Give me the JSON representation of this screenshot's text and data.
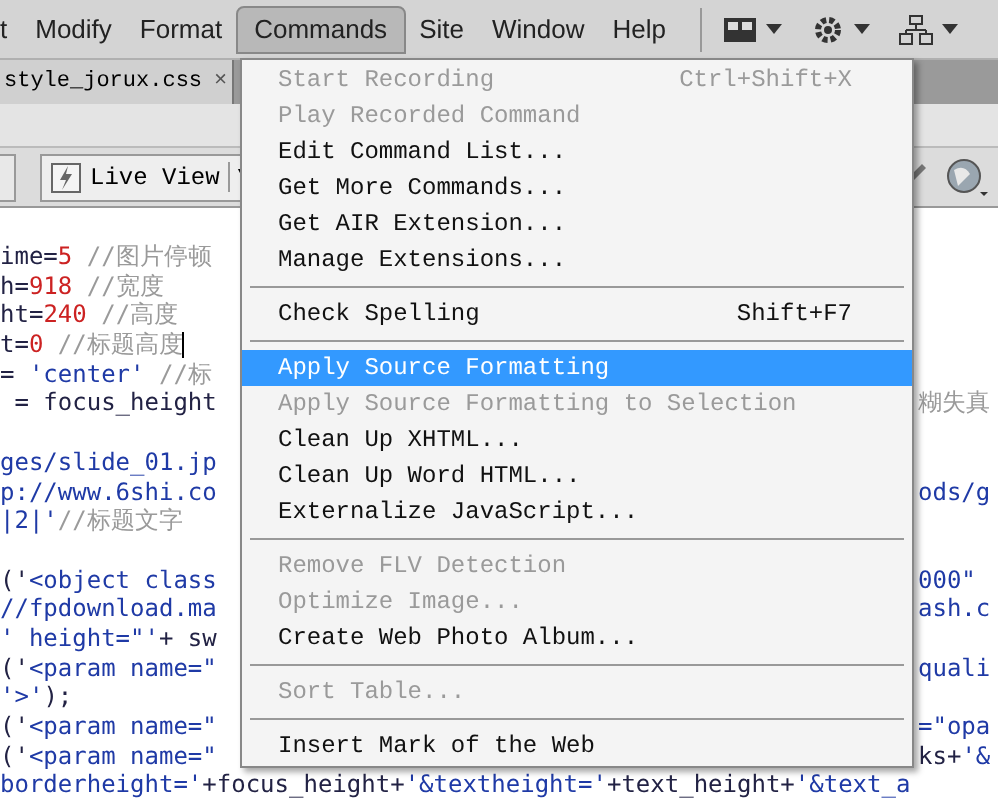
{
  "menu_bar": {
    "items": [
      {
        "label": "t",
        "selected": false
      },
      {
        "label": "Modify",
        "selected": false
      },
      {
        "label": "Format",
        "selected": false
      },
      {
        "label": "Commands",
        "selected": true
      },
      {
        "label": "Site",
        "selected": false
      },
      {
        "label": "Window",
        "selected": false
      },
      {
        "label": "Help",
        "selected": false
      }
    ]
  },
  "document_tabs": [
    {
      "label": "style_jorux.css",
      "close": "×"
    }
  ],
  "toolbar": {
    "live_view": {
      "label": "Live View"
    }
  },
  "code": [
    {
      "kind": "code",
      "left": [
        {
          "text": "ime=",
          "kind": "plain"
        },
        {
          "text": "5",
          "kind": "number"
        },
        {
          "text": " //图片停顿",
          "kind": "comment"
        }
      ]
    },
    {
      "kind": "code",
      "left": [
        {
          "text": "h=",
          "kind": "plain"
        },
        {
          "text": "918",
          "kind": "number"
        },
        {
          "text": " //宽度",
          "kind": "comment"
        }
      ]
    },
    {
      "kind": "code",
      "left": [
        {
          "text": "ht=",
          "kind": "plain"
        },
        {
          "text": "240",
          "kind": "number"
        },
        {
          "text": " //高度",
          "kind": "comment"
        }
      ]
    },
    {
      "kind": "code",
      "left": [
        {
          "text": "t=",
          "kind": "plain"
        },
        {
          "text": "0",
          "kind": "number"
        },
        {
          "text": " //标题高度",
          "kind": "comment"
        }
      ],
      "cursor": true
    },
    {
      "kind": "code",
      "left": [
        {
          "text": "= ",
          "kind": "plain"
        },
        {
          "text": "'center'",
          "kind": "string"
        },
        {
          "text": " //标",
          "kind": "comment"
        }
      ]
    },
    {
      "kind": "code",
      "left": [
        {
          "text": " = focus_height",
          "kind": "plain"
        }
      ],
      "right": [
        {
          "text": "糊失真",
          "kind": "comment"
        }
      ]
    },
    {
      "kind": "blank"
    },
    {
      "kind": "code",
      "left": [
        {
          "text": "ges/slide_01.jp",
          "kind": "string"
        }
      ]
    },
    {
      "kind": "code",
      "left": [
        {
          "text": "p://www.6shi.co",
          "kind": "string"
        }
      ],
      "right": [
        {
          "text": "ods/g",
          "kind": "string"
        }
      ]
    },
    {
      "kind": "code",
      "left": [
        {
          "text": "|2|'",
          "kind": "string"
        },
        {
          "text": "//标题文字",
          "kind": "comment"
        }
      ]
    },
    {
      "kind": "blank"
    },
    {
      "kind": "code",
      "left": [
        {
          "text": "('",
          "kind": "plain"
        },
        {
          "text": "<object class",
          "kind": "string"
        }
      ],
      "right": [
        {
          "text": "000\"",
          "kind": "string"
        }
      ]
    },
    {
      "kind": "code",
      "left": [
        {
          "text": "//fpdownload.ma",
          "kind": "string"
        }
      ],
      "right": [
        {
          "text": "ash.c",
          "kind": "string"
        }
      ]
    },
    {
      "kind": "code",
      "left": [
        {
          "text": "' height=\"'",
          "kind": "string"
        },
        {
          "text": "+ sw",
          "kind": "plain"
        }
      ]
    },
    {
      "kind": "code",
      "left": [
        {
          "text": "('",
          "kind": "plain"
        },
        {
          "text": "<param name=\"",
          "kind": "string"
        }
      ],
      "right": [
        {
          "text": "quali",
          "kind": "string"
        }
      ]
    },
    {
      "kind": "code",
      "left": [
        {
          "text": "'>'",
          "kind": "string"
        },
        {
          "text": ");",
          "kind": "plain"
        }
      ]
    },
    {
      "kind": "code",
      "left": [
        {
          "text": "('",
          "kind": "plain"
        },
        {
          "text": "<param name=\"",
          "kind": "string"
        }
      ],
      "right": [
        {
          "text": "=\"opa",
          "kind": "string"
        }
      ]
    },
    {
      "kind": "code",
      "left": [
        {
          "text": "('",
          "kind": "plain"
        },
        {
          "text": "<param name=\"",
          "kind": "string"
        }
      ],
      "right": [
        {
          "text": "ks+",
          "kind": "plain"
        },
        {
          "text": "'&",
          "kind": "string"
        }
      ]
    },
    {
      "kind": "code",
      "left": [
        {
          "text": "borderheight='",
          "kind": "string"
        },
        {
          "text": "+focus_height+",
          "kind": "plain"
        },
        {
          "text": "'&textheight='",
          "kind": "string"
        },
        {
          "text": "+text_height+",
          "kind": "plain"
        },
        {
          "text": "'&text_a",
          "kind": "string"
        }
      ]
    }
  ],
  "commands_menu": {
    "items": [
      {
        "kind": "item",
        "label": "Start Recording",
        "shortcut": "Ctrl+Shift+X",
        "disabled": true,
        "selected": false
      },
      {
        "kind": "item",
        "label": "Play Recorded Command",
        "disabled": true,
        "selected": false
      },
      {
        "kind": "item",
        "label": "Edit Command List...",
        "disabled": false,
        "selected": false
      },
      {
        "kind": "item",
        "label": "Get More Commands...",
        "disabled": false,
        "selected": false
      },
      {
        "kind": "item",
        "label": "Get AIR Extension...",
        "disabled": false,
        "selected": false
      },
      {
        "kind": "item",
        "label": "Manage Extensions...",
        "disabled": false,
        "selected": false
      },
      {
        "kind": "separator"
      },
      {
        "kind": "item",
        "label": "Check Spelling",
        "shortcut": "Shift+F7",
        "disabled": false,
        "selected": false
      },
      {
        "kind": "separator"
      },
      {
        "kind": "item",
        "label": "Apply Source Formatting",
        "disabled": false,
        "selected": true
      },
      {
        "kind": "item",
        "label": "Apply Source Formatting to Selection",
        "disabled": true,
        "selected": false
      },
      {
        "kind": "item",
        "label": "Clean Up XHTML...",
        "disabled": false,
        "selected": false
      },
      {
        "kind": "item",
        "label": "Clean Up Word HTML...",
        "disabled": false,
        "selected": false
      },
      {
        "kind": "item",
        "label": "Externalize JavaScript...",
        "disabled": false,
        "selected": false
      },
      {
        "kind": "separator"
      },
      {
        "kind": "item",
        "label": "Remove FLV Detection",
        "disabled": true,
        "selected": false
      },
      {
        "kind": "item",
        "label": "Optimize Image...",
        "disabled": true,
        "selected": false
      },
      {
        "kind": "item",
        "label": "Create Web Photo Album...",
        "disabled": false,
        "selected": false
      },
      {
        "kind": "separator"
      },
      {
        "kind": "item",
        "label": "Sort Table...",
        "disabled": true,
        "selected": false
      },
      {
        "kind": "separator"
      },
      {
        "kind": "item",
        "label": "Insert Mark of the Web",
        "disabled": false,
        "selected": false
      }
    ]
  }
}
